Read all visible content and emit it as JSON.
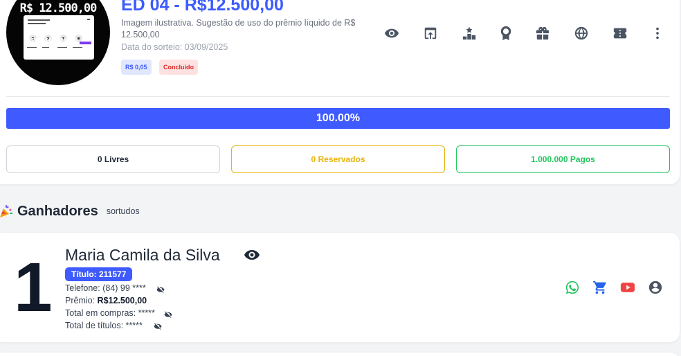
{
  "edition": {
    "thumbnail": {
      "price_text": "R$ 12.500,00",
      "footer_text": "LIVRE DE IMPOSTOS"
    },
    "title": "ED 04 - R$12.500,00",
    "description": "Imagem ilustrativa. Sugestão de uso do prêmio líquido de R$ 12.500,00",
    "draw_date": "Data do sorteio: 03/09/2025",
    "price_badge": "R$ 0,05",
    "status_badge": "Concluído",
    "actions": [
      "eye-icon",
      "share-icon",
      "podium-icon",
      "award-icon",
      "gift-icon",
      "ball-icon",
      "ticket-icon",
      "more-vertical-icon"
    ]
  },
  "progress": {
    "percent": 100,
    "text": "100.00%"
  },
  "stats": {
    "free": "0 Livres",
    "reserved": "0 Reservados",
    "paid": "1.000.000 Pagos"
  },
  "winners_section": {
    "title": "Ganhadores",
    "subtitle": "sortudos"
  },
  "winner": {
    "rank": "1",
    "name": "Maria Camila da Silva",
    "ticket": "Título: 211577",
    "phone": "Telefone: (84) 99 ****",
    "prize_label": "Prêmio: ",
    "prize_value": "R$12.500,00",
    "total_purchases": "Total em compras: *****",
    "total_tickets": "Total de títulos: *****",
    "contacts": [
      "whatsapp-icon",
      "cart-icon",
      "youtube-icon",
      "user-icon"
    ]
  },
  "colors": {
    "accent": "#3f5bff",
    "reserved": "#eab308",
    "paid": "#22c55e",
    "status_red": "#dc2626"
  }
}
